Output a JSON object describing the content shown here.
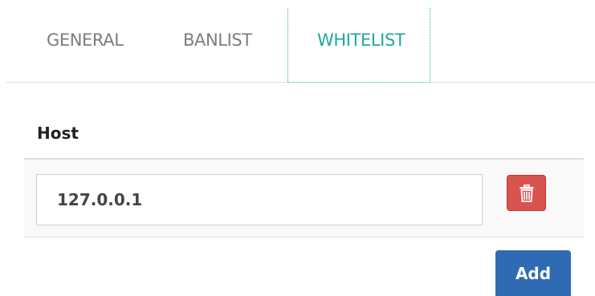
{
  "tabs": {
    "general": "GENERAL",
    "banlist": "BANLIST",
    "whitelist": "WHITELIST",
    "active": "WHITELIST"
  },
  "host_section": {
    "label": "Host",
    "entries": [
      {
        "value": "127.0.0.1"
      }
    ],
    "delete_icon": "trash-icon",
    "add_label": "Add"
  },
  "colors": {
    "active_tab": "#1fa99c",
    "delete_button": "#d9534f",
    "add_button": "#2f6bb3"
  }
}
